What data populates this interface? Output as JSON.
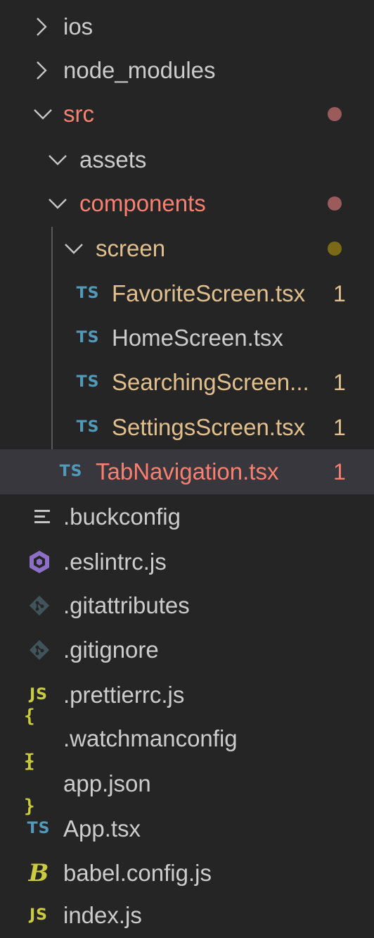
{
  "colors": {
    "background": "#252526",
    "selected_row": "#37373d",
    "text_default": "#cccccc",
    "text_error": "#f88070",
    "text_warning": "#e2c08d",
    "dot_error": "#9a5b5a",
    "dot_warning": "#7a6a18",
    "ts_icon": "#519aba",
    "js_icon": "#cbcb41",
    "eslint_icon": "#8e6fc7",
    "git_icon": "#41535b"
  },
  "explorer": {
    "folders": {
      "ios": "ios",
      "node_modules": "node_modules",
      "src": "src",
      "assets": "assets",
      "components": "components",
      "screen": "screen"
    },
    "files": {
      "favorite": {
        "name": "FavoriteScreen.tsx",
        "icon": "TS",
        "badge": "1"
      },
      "home": {
        "name": "HomeScreen.tsx",
        "icon": "TS"
      },
      "searching": {
        "name": "SearchingScreen...",
        "icon": "TS",
        "badge": "1"
      },
      "settings": {
        "name": "SettingsScreen.tsx",
        "icon": "TS",
        "badge": "1"
      },
      "tabnav": {
        "name": "TabNavigation.tsx",
        "icon": "TS",
        "badge": "1"
      },
      "buckconfig": {
        "name": ".buckconfig"
      },
      "eslintrc": {
        "name": ".eslintrc.js"
      },
      "gitattributes": {
        "name": ".gitattributes"
      },
      "gitignore": {
        "name": ".gitignore"
      },
      "prettierrc": {
        "name": ".prettierrc.js",
        "icon": "JS"
      },
      "watchmanconfig": {
        "name": ".watchmanconfig",
        "icon": "{ }"
      },
      "appjson": {
        "name": "app.json",
        "icon": "{ }"
      },
      "apptsx": {
        "name": "App.tsx",
        "icon": "TS"
      },
      "babel": {
        "name": "babel.config.js",
        "icon": "B"
      },
      "index": {
        "name": "index.js",
        "icon": "JS"
      }
    }
  }
}
